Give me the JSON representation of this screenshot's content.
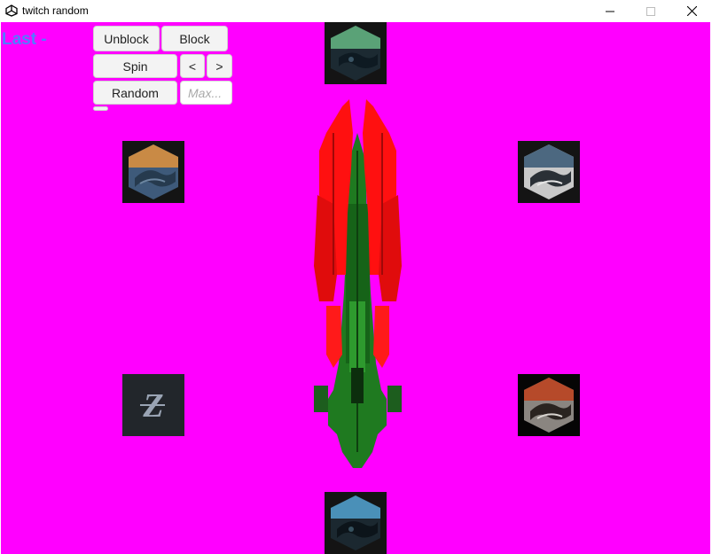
{
  "window": {
    "title": "twitch random"
  },
  "game": {
    "last_label": "Last -",
    "buttons": {
      "unblock": "Unblock",
      "block": "Block",
      "spin": "Spin",
      "prev": "<",
      "next": ">",
      "random": "Random"
    },
    "max_placeholder": "Max...",
    "tiles": [
      {
        "icon": "faction-emblem-green-icon",
        "accent": "#5aa277"
      },
      {
        "icon": "faction-emblem-orange-icon",
        "accent": "#c98a45"
      },
      {
        "icon": "faction-emblem-slate-icon",
        "accent": "#4c6880"
      },
      {
        "icon": "z-letter-icon",
        "accent": "#9aa4b4"
      },
      {
        "icon": "faction-emblem-red-icon",
        "accent": "#b64a2a"
      },
      {
        "icon": "faction-emblem-blue-icon",
        "accent": "#4a90b8"
      }
    ]
  },
  "colors": {
    "background": "#ff00ff",
    "label": "#4f7cff",
    "ship_red": "#ff1010",
    "ship_green": "#1f7a20"
  }
}
